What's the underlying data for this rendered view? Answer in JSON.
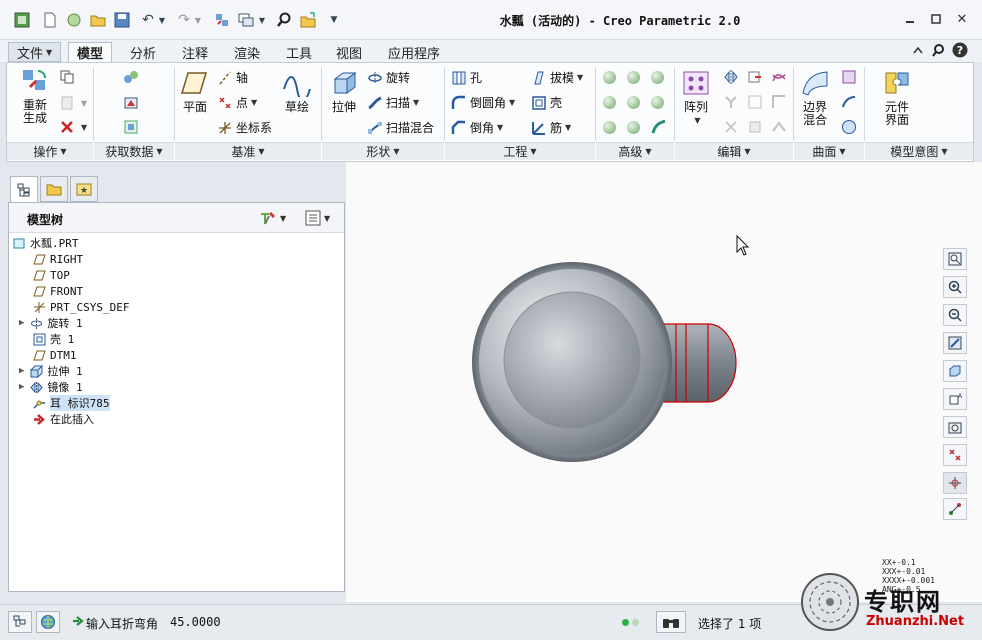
{
  "window": {
    "title": "水瓢 (活动的) - Creo Parametric 2.0",
    "minimize_icon": "minimize-icon",
    "restore_icon": "restore-icon",
    "close_icon": "close-icon"
  },
  "ribbon_tabs": [
    "文件",
    "模型",
    "分析",
    "注释",
    "渲染",
    "工具",
    "视图",
    "应用程序"
  ],
  "active_tab": "模型",
  "ribbon": {
    "groups": {
      "operations": "操作",
      "get_data": "获取数据",
      "datum": "基准",
      "shapes": "形状",
      "engineering": "工程",
      "advanced": "高级",
      "editing": "编辑",
      "surfaces": "曲面",
      "model_intent": "模型意图"
    },
    "regenerate": "重新生成",
    "plane": "平面",
    "axis": "轴",
    "point": "点",
    "csys": "坐标系",
    "sketch": "草绘",
    "extrude": "拉伸",
    "revolve": "旋转",
    "sweep": "扫描",
    "swept_blend": "扫描混合",
    "hole": "孔",
    "round": "倒圆角",
    "chamfer": "倒角",
    "draft": "拔模",
    "shell": "壳",
    "rib": "筋",
    "pattern": "阵列",
    "boundary_blend": "边界混合",
    "component_interface": "元件界面"
  },
  "model_tree": {
    "title": "模型树",
    "items": [
      {
        "label": "水瓢.PRT",
        "icon": "part-icon"
      },
      {
        "label": "RIGHT",
        "icon": "datum-plane-icon"
      },
      {
        "label": "TOP",
        "icon": "datum-plane-icon"
      },
      {
        "label": "FRONT",
        "icon": "datum-plane-icon"
      },
      {
        "label": "PRT_CSYS_DEF",
        "icon": "csys-icon"
      },
      {
        "label": "旋转 1",
        "icon": "revolve-icon"
      },
      {
        "label": "壳 1",
        "icon": "shell-icon"
      },
      {
        "label": "DTM1",
        "icon": "datum-plane-icon"
      },
      {
        "label": "拉伸 1",
        "icon": "extrude-icon"
      },
      {
        "label": "镜像 1",
        "icon": "mirror-icon"
      },
      {
        "label": "耳 标识785",
        "icon": "ear-icon"
      },
      {
        "label": "在此插入",
        "icon": "insert-arrow-icon"
      }
    ]
  },
  "status": {
    "prompt": "输入耳折弯角",
    "value": "45.0000",
    "selection": "选择了 1 项"
  },
  "readout": {
    "lines": [
      "XX+-0.1",
      "XXX+-0.01",
      "XXXX+-0.001",
      "ANG+-0.5"
    ]
  },
  "watermark": {
    "text": "专职网",
    "url": "Zhuanzhi.Net"
  },
  "colors": {
    "canvas_bg": "#fafafa",
    "model_gray": "#7f858c",
    "edge_highlight": "#cc0000",
    "ribbon_bg": "#fbfcfd"
  }
}
